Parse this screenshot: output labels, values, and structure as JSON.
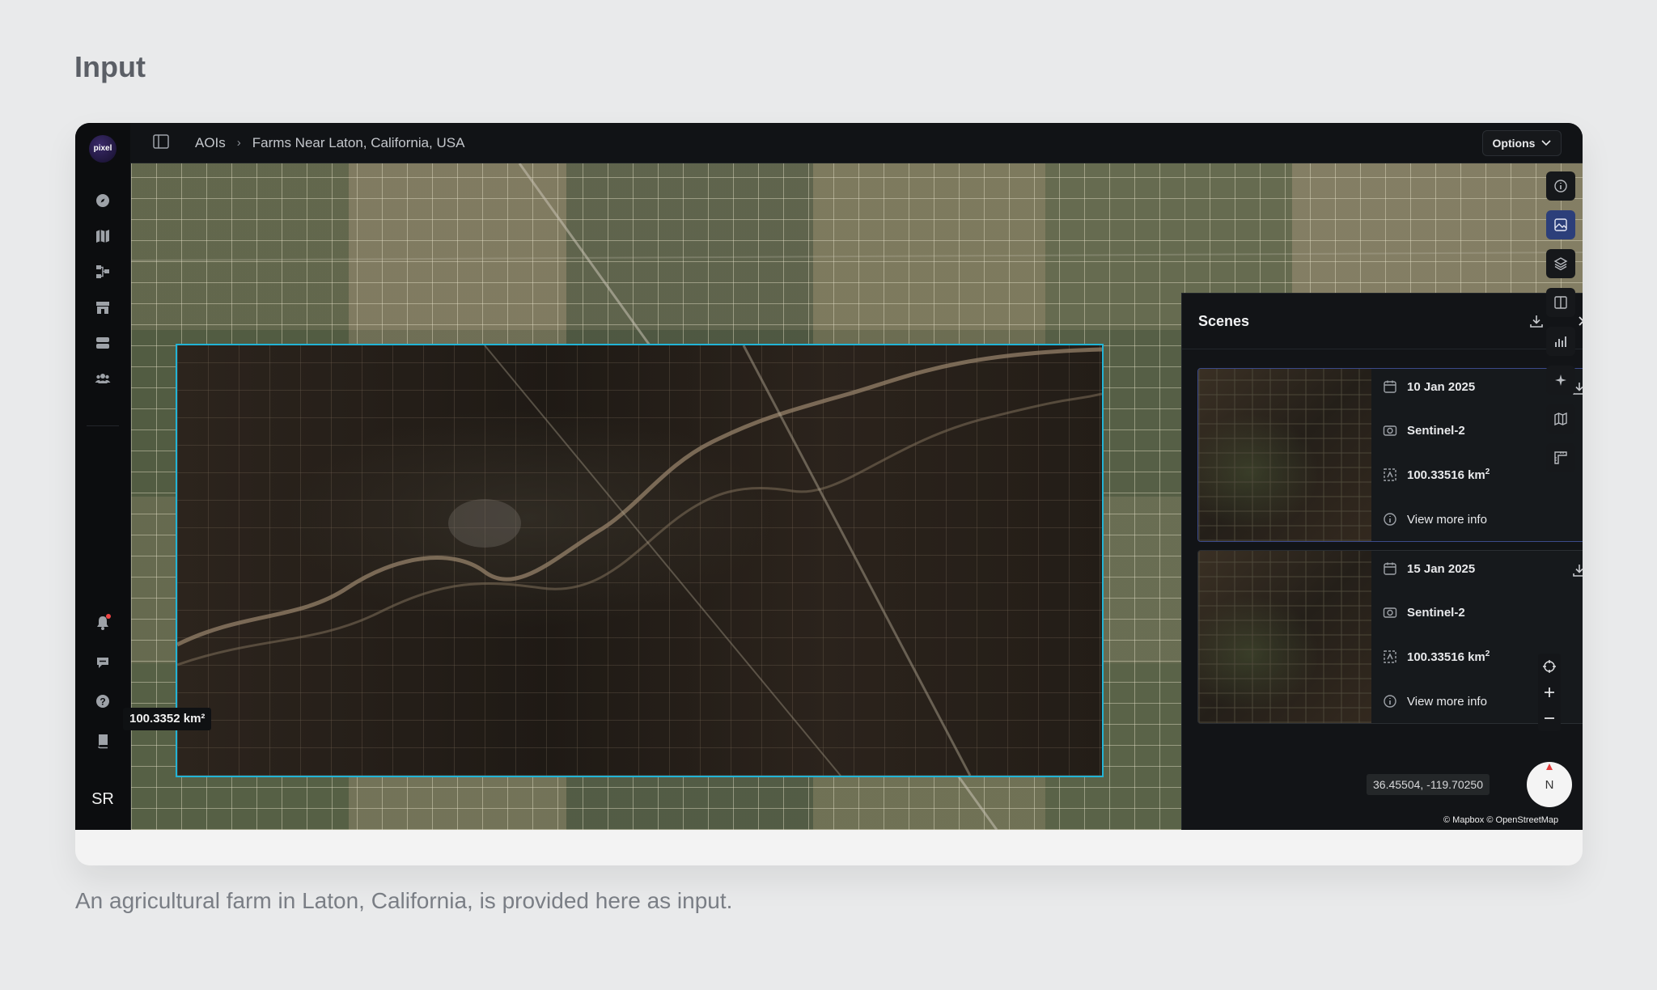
{
  "page": {
    "heading": "Input",
    "caption": "An agricultural farm in Laton, California, is provided here as input."
  },
  "sidebar": {
    "logo_text": "pixel",
    "nav_icons": [
      "compass-icon",
      "map-icon",
      "workflow-icon",
      "store-icon",
      "database-icon",
      "team-icon"
    ],
    "bottom_icons": [
      "bell-icon",
      "chat-icon",
      "help-icon",
      "docs-icon"
    ],
    "avatar_initials": "SR"
  },
  "topbar": {
    "breadcrumb": [
      "AOIs",
      "Farms Near Laton, California, USA"
    ],
    "options_label": "Options"
  },
  "map": {
    "aoi_area_label": "100.3352 km²",
    "aoi_border_color": "#22b4d6",
    "coordinates": "36.45504, -119.70250",
    "compass_label": "N",
    "attribution": "© Mapbox © OpenStreetMap"
  },
  "scenes_panel": {
    "title": "Scenes",
    "scenes": [
      {
        "date": "10 Jan 2025",
        "satellite": "Sentinel-2",
        "area_value": "100.33516 km",
        "area_sup": "2",
        "more_info": "View more info",
        "selected": true
      },
      {
        "date": "15 Jan 2025",
        "satellite": "Sentinel-2",
        "area_value": "100.33516 km",
        "area_sup": "2",
        "more_info": "View more info",
        "selected": false
      }
    ]
  },
  "right_toolbar": {
    "tools": [
      "info-icon",
      "scenes-icon",
      "layers-icon",
      "split-view-icon",
      "chart-icon",
      "ai-sparkle-icon",
      "map-style-icon",
      "ruler-icon"
    ],
    "active_tool": "scenes-icon"
  },
  "colors": {
    "accent": "#2c3f7a",
    "aoi": "#22b4d6",
    "background": "#e9eaeb"
  }
}
